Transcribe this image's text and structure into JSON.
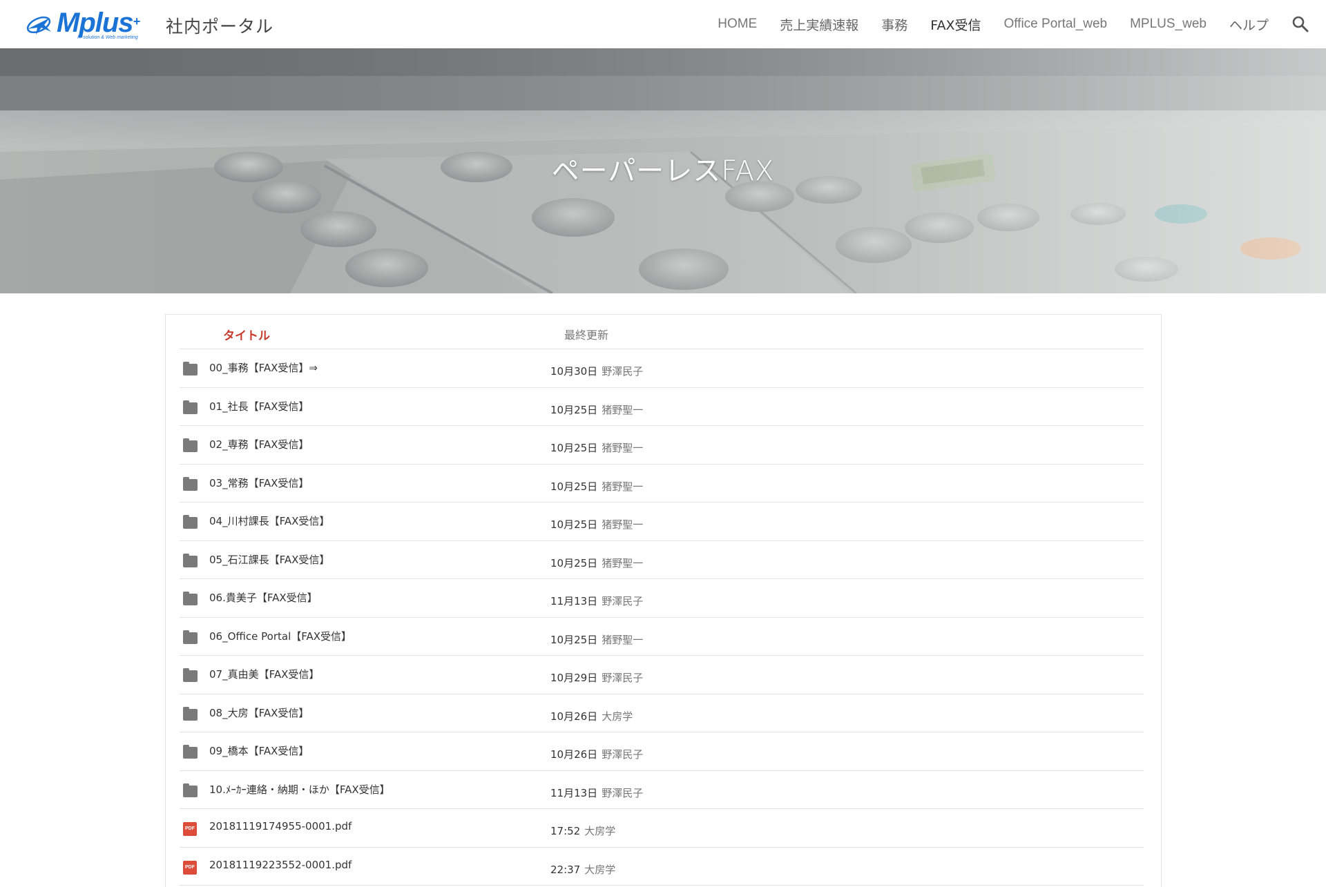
{
  "header": {
    "logo_text": "Mplus",
    "logo_plus": "+",
    "logo_tagline": "IT solution & Web marketing",
    "site_title": "社内ポータル",
    "nav": [
      {
        "label": "HOME"
      },
      {
        "label": "売上実績速報"
      },
      {
        "label": "事務"
      },
      {
        "label": "FAX受信",
        "active": true
      },
      {
        "label": "Office Portal_web"
      },
      {
        "label": "MPLUS_web"
      },
      {
        "label": "ヘルプ"
      }
    ],
    "search_icon": "search-icon"
  },
  "hero": {
    "title": "ペーパーレスFAX"
  },
  "table": {
    "col_title": "タイトル",
    "col_updated": "最終更新",
    "rows": [
      {
        "icon": "folder-icon",
        "name": "00_事務【FAX受信】⇒",
        "date": "10月30日",
        "user": "野澤民子"
      },
      {
        "icon": "folder-icon",
        "name": "01_社長【FAX受信】",
        "date": "10月25日",
        "user": "猪野聖一"
      },
      {
        "icon": "folder-icon",
        "name": "02_専務【FAX受信】",
        "date": "10月25日",
        "user": "猪野聖一"
      },
      {
        "icon": "folder-icon",
        "name": "03_常務【FAX受信】",
        "date": "10月25日",
        "user": "猪野聖一"
      },
      {
        "icon": "folder-icon",
        "name": "04_川村課長【FAX受信】",
        "date": "10月25日",
        "user": "猪野聖一"
      },
      {
        "icon": "folder-icon",
        "name": "05_石江課長【FAX受信】",
        "date": "10月25日",
        "user": "猪野聖一"
      },
      {
        "icon": "folder-icon",
        "name": "06.貴美子【FAX受信】",
        "date": "11月13日",
        "user": "野澤民子"
      },
      {
        "icon": "folder-icon",
        "name": "06_Office Portal【FAX受信】",
        "date": "10月25日",
        "user": "猪野聖一"
      },
      {
        "icon": "folder-icon",
        "name": "07_真由美【FAX受信】",
        "date": "10月29日",
        "user": "野澤民子"
      },
      {
        "icon": "folder-icon",
        "name": "08_大房【FAX受信】",
        "date": "10月26日",
        "user": "大房学"
      },
      {
        "icon": "folder-icon",
        "name": "09_橋本【FAX受信】",
        "date": "10月26日",
        "user": "野澤民子"
      },
      {
        "icon": "folder-icon",
        "name": "10.ﾒｰｶｰ連絡・納期・ほか【FAX受信】",
        "date": "11月13日",
        "user": "野澤民子"
      },
      {
        "icon": "pdf-icon",
        "name": "20181119174955-0001.pdf",
        "date": "17:52",
        "user": "大房学"
      },
      {
        "icon": "pdf-icon",
        "name": "20181119223552-0001.pdf",
        "date": "22:37",
        "user": "大房学"
      }
    ],
    "pdf_badge": "PDF"
  }
}
